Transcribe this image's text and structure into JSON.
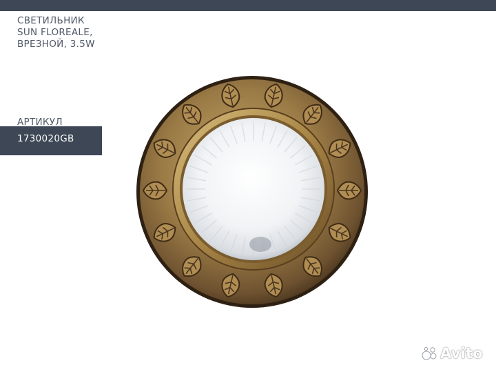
{
  "header": {
    "title_lines": [
      "СВЕТИЛЬНИК",
      "SUN FLOREALE,",
      "ВРЕЗНОЙ, 3.5W"
    ]
  },
  "article": {
    "label": "АРТИКУЛ",
    "value": "1730020GB"
  },
  "watermark": {
    "text": "Avito"
  },
  "colors": {
    "bar": "#3d4756",
    "text": "#4f5968",
    "brass_dark": "#4a3520",
    "brass_light": "#b89a5e"
  },
  "image": {
    "subject": "lamp-photo"
  }
}
